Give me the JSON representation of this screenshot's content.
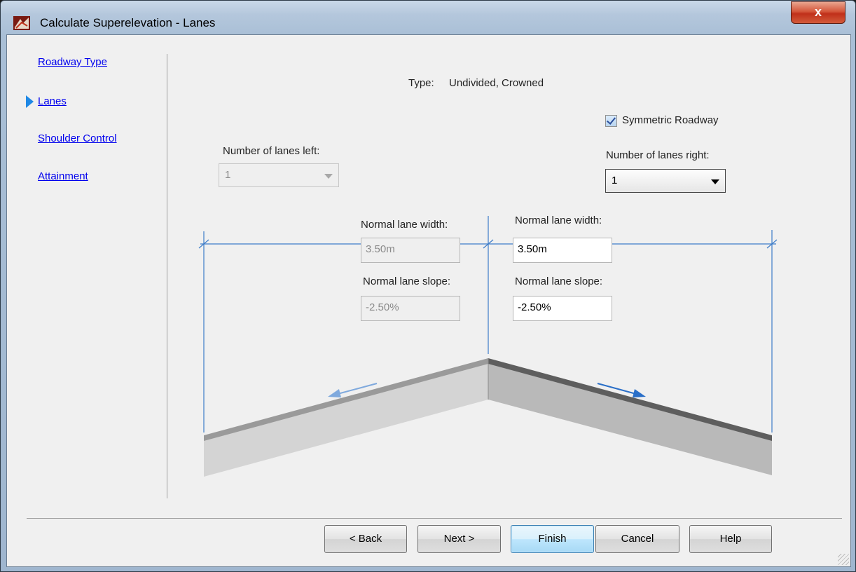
{
  "window": {
    "title": "Calculate Superelevation - Lanes",
    "close_label": "x"
  },
  "nav": {
    "items": [
      {
        "label": "Roadway Type"
      },
      {
        "label": "Lanes"
      },
      {
        "label": "Shoulder Control"
      },
      {
        "label": "Attainment"
      }
    ],
    "active_index": 1
  },
  "content": {
    "type_label": "Type:",
    "type_value": "Undivided, Crowned",
    "symmetric_label": "Symmetric Roadway",
    "symmetric_checked": true,
    "lanes_left": {
      "label": "Number of lanes left:",
      "value": "1",
      "enabled": false
    },
    "lanes_right": {
      "label": "Number of lanes right:",
      "value": "1",
      "enabled": true
    },
    "left": {
      "width_label": "Normal lane width:",
      "width_value": "3.50m",
      "slope_label": "Normal lane slope:",
      "slope_value": "-2.50%"
    },
    "right": {
      "width_label": "Normal lane width:",
      "width_value": "3.50m",
      "slope_label": "Normal lane slope:",
      "slope_value": "-2.50%"
    }
  },
  "buttons": {
    "back": "< Back",
    "next": "Next >",
    "finish": "Finish",
    "cancel": "Cancel",
    "help": "Help"
  },
  "colors": {
    "accent": "#1e88e5",
    "dimension_line": "#3d7cc9",
    "link": "#0000ee"
  }
}
